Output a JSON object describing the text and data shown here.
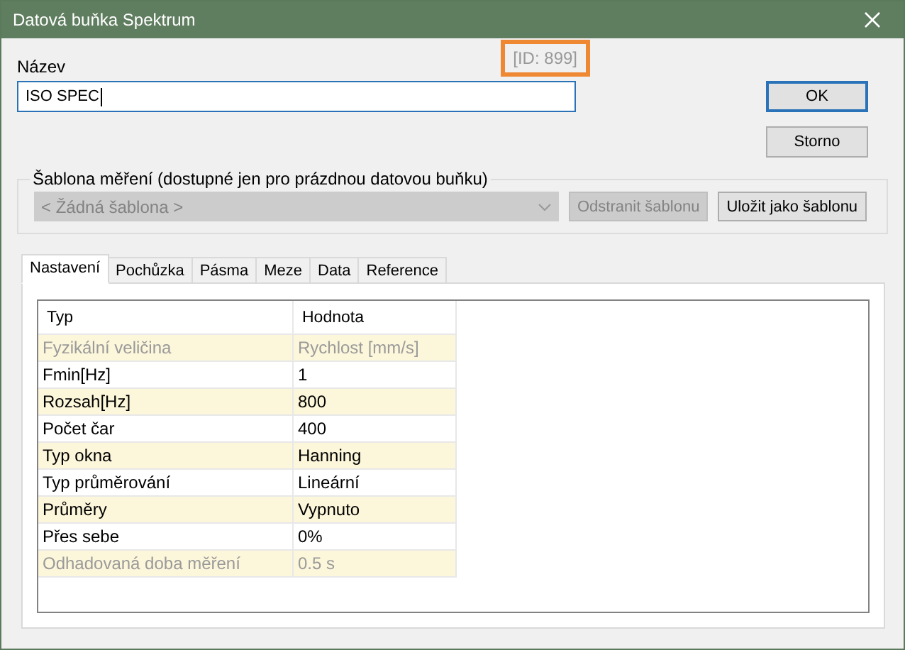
{
  "window": {
    "title": "Datová buňka Spektrum"
  },
  "name_field": {
    "label": "Název",
    "value": "ISO SPEC",
    "id_text": "[ID: 899]"
  },
  "buttons": [
    {
      "label": "OK",
      "default": true
    },
    {
      "label": "Storno",
      "default": false
    }
  ],
  "template_group": {
    "label": "Šablona měření (dostupné jen pro prázdnou datovou buňku)",
    "dropdown": {
      "value": "< Žádná šablona >",
      "disabled": true
    },
    "buttons": [
      {
        "label": "Odstranit šablonu",
        "disabled": true
      },
      {
        "label": "Uložit jako šablonu",
        "disabled": false
      }
    ]
  },
  "tabs": [
    {
      "label": "Nastavení",
      "selected": true
    },
    {
      "label": "Pochůzka",
      "selected": false
    },
    {
      "label": "Pásma",
      "selected": false
    },
    {
      "label": "Meze",
      "selected": false
    },
    {
      "label": "Data",
      "selected": false
    },
    {
      "label": "Reference",
      "selected": false
    }
  ],
  "table": {
    "columns": [
      "Typ",
      "Hodnota"
    ],
    "rows": [
      {
        "name": "Fyzikální veličina",
        "value": "Rychlost [mm/s]",
        "disabled": true
      },
      {
        "name": "Fmin[Hz]",
        "value": "1",
        "disabled": false
      },
      {
        "name": "Rozsah[Hz]",
        "value": "800",
        "disabled": false
      },
      {
        "name": "Počet čar",
        "value": "400",
        "disabled": false
      },
      {
        "name": "Typ okna",
        "value": "Hanning",
        "disabled": false
      },
      {
        "name": "Typ průměrování",
        "value": "Lineární",
        "disabled": false
      },
      {
        "name": "Průměry",
        "value": "Vypnuto",
        "disabled": false
      },
      {
        "name": "Přes sebe",
        "value": "0%",
        "disabled": false
      },
      {
        "name": "Odhadovaná doba měření",
        "value": "0.5 s",
        "disabled": true
      }
    ]
  }
}
